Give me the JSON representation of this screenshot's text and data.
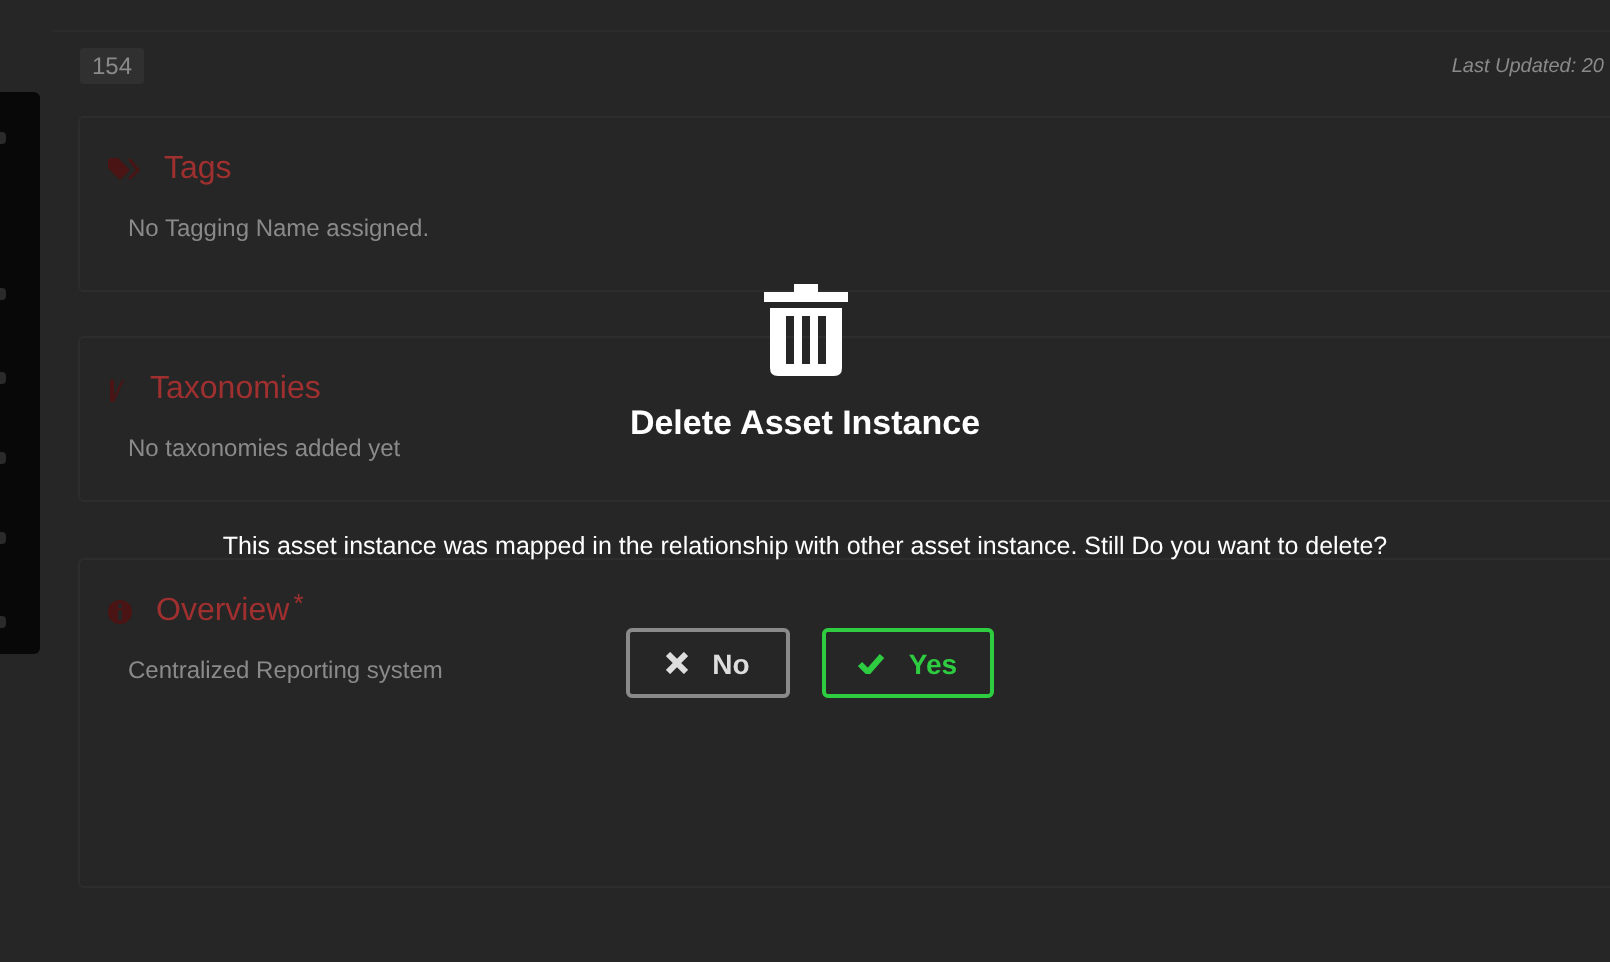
{
  "record": {
    "id": "154",
    "last_updated": "Last Updated: 20"
  },
  "sections": [
    {
      "kind": "tags",
      "title": "Tags",
      "text": "No Tagging Name assigned."
    },
    {
      "kind": "taxonomies",
      "title": "Taxonomies",
      "text": "No taxonomies added yet"
    },
    {
      "kind": "overview",
      "title": "Overview",
      "required_mark": "*",
      "text": "Centralized Reporting system"
    }
  ],
  "dialog": {
    "title": "Delete Asset Instance",
    "message": "This asset instance was mapped in the relationship with other asset instance. Still Do you want to delete?",
    "buttons": [
      {
        "kind": "cancel",
        "label": "No"
      },
      {
        "kind": "confirm",
        "label": "Yes"
      }
    ]
  }
}
